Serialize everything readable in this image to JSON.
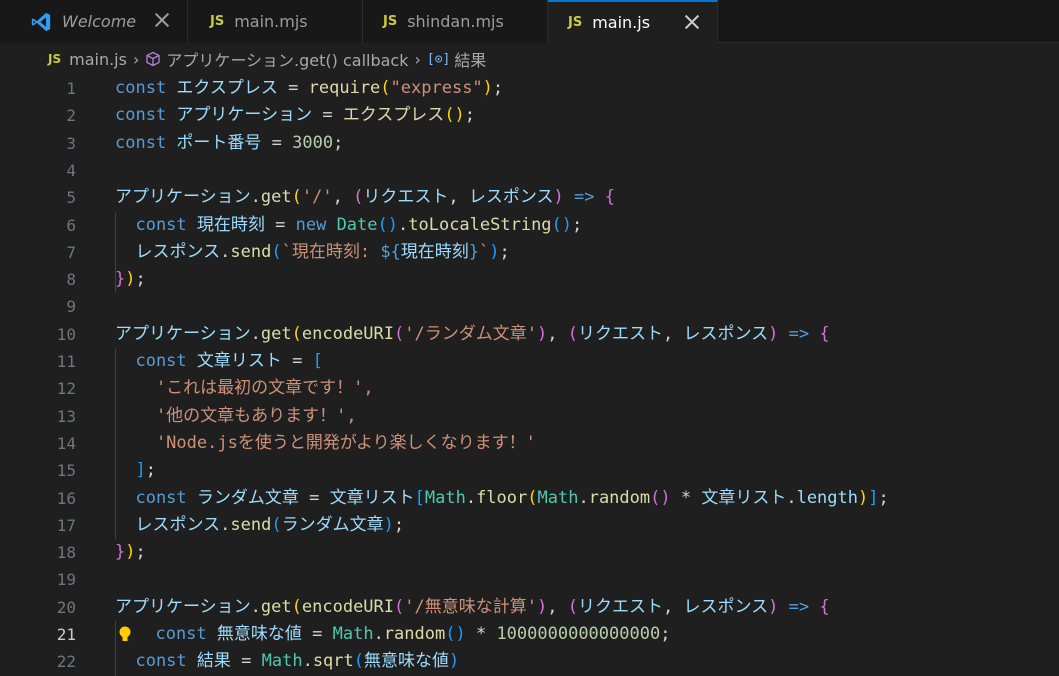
{
  "tabs": [
    {
      "label": "Welcome"
    },
    {
      "icon": "JS",
      "label": "main.mjs"
    },
    {
      "icon": "JS",
      "label": "shindan.mjs"
    },
    {
      "icon": "JS",
      "label": "main.js"
    }
  ],
  "breadcrumb": {
    "icon": "JS",
    "file": "main.js",
    "scope": "アプリケーション.get() callback",
    "symbol": "結果"
  },
  "lines": [
    {
      "n": "1",
      "tokens": [
        [
          "const ",
          "kw"
        ],
        [
          "エクスプレス",
          "var"
        ],
        [
          " = ",
          "op"
        ],
        [
          "require",
          "fn"
        ],
        [
          "(",
          "b1"
        ],
        [
          "\"express\"",
          "str"
        ],
        [
          ")",
          "b1"
        ],
        [
          ";",
          "op"
        ]
      ]
    },
    {
      "n": "2",
      "tokens": [
        [
          "const ",
          "kw"
        ],
        [
          "アプリケーション",
          "var"
        ],
        [
          " = ",
          "op"
        ],
        [
          "エクスプレス",
          "fn"
        ],
        [
          "()",
          "b1"
        ],
        [
          ";",
          "op"
        ]
      ]
    },
    {
      "n": "3",
      "tokens": [
        [
          "const ",
          "kw"
        ],
        [
          "ポート番号",
          "var"
        ],
        [
          " = ",
          "op"
        ],
        [
          "3000",
          "num"
        ],
        [
          ";",
          "op"
        ]
      ]
    },
    {
      "n": "4",
      "tokens": []
    },
    {
      "n": "5",
      "tokens": [
        [
          "アプリケーション",
          "var"
        ],
        [
          ".",
          "op"
        ],
        [
          "get",
          "fn"
        ],
        [
          "(",
          "b1"
        ],
        [
          "'/'",
          "str"
        ],
        [
          ", ",
          "op"
        ],
        [
          "(",
          "b2"
        ],
        [
          "リクエスト",
          "var"
        ],
        [
          ", ",
          "op"
        ],
        [
          "レスポンス",
          "var"
        ],
        [
          ")",
          "b2"
        ],
        [
          " => ",
          "kw"
        ],
        [
          "{",
          "b2"
        ]
      ]
    },
    {
      "n": "6",
      "tokens": [
        [
          "  const ",
          "kw"
        ],
        [
          "現在時刻",
          "var"
        ],
        [
          " = ",
          "op"
        ],
        [
          "new ",
          "kw"
        ],
        [
          "Date",
          "ty"
        ],
        [
          "()",
          "b3"
        ],
        [
          ".",
          "op"
        ],
        [
          "toLocaleString",
          "fn"
        ],
        [
          "()",
          "b3"
        ],
        [
          ";",
          "op"
        ]
      ]
    },
    {
      "n": "7",
      "tokens": [
        [
          "  レスポンス",
          "var"
        ],
        [
          ".",
          "op"
        ],
        [
          "send",
          "fn"
        ],
        [
          "(",
          "b3"
        ],
        [
          "`現在時刻: ",
          "str"
        ],
        [
          "${",
          "kw"
        ],
        [
          "現在時刻",
          "var"
        ],
        [
          "}",
          "kw"
        ],
        [
          "`",
          "str"
        ],
        [
          ")",
          "b3"
        ],
        [
          ";",
          "op"
        ]
      ]
    },
    {
      "n": "8",
      "tokens": [
        [
          "}",
          "b2"
        ],
        [
          ")",
          "b1"
        ],
        [
          ";",
          "op"
        ]
      ]
    },
    {
      "n": "9",
      "tokens": []
    },
    {
      "n": "10",
      "tokens": [
        [
          "アプリケーション",
          "var"
        ],
        [
          ".",
          "op"
        ],
        [
          "get",
          "fn"
        ],
        [
          "(",
          "b1"
        ],
        [
          "encodeURI",
          "fn"
        ],
        [
          "(",
          "b2"
        ],
        [
          "'/ランダム文章'",
          "str"
        ],
        [
          ")",
          "b2"
        ],
        [
          ", ",
          "op"
        ],
        [
          "(",
          "b2"
        ],
        [
          "リクエスト",
          "var"
        ],
        [
          ", ",
          "op"
        ],
        [
          "レスポンス",
          "var"
        ],
        [
          ")",
          "b2"
        ],
        [
          " => ",
          "kw"
        ],
        [
          "{",
          "b2"
        ]
      ]
    },
    {
      "n": "11",
      "tokens": [
        [
          "  const ",
          "kw"
        ],
        [
          "文章リスト",
          "var"
        ],
        [
          " = ",
          "op"
        ],
        [
          "[",
          "b3"
        ]
      ]
    },
    {
      "n": "12",
      "tokens": [
        [
          "    'これは最初の文章です！',",
          "str"
        ]
      ]
    },
    {
      "n": "13",
      "tokens": [
        [
          "    '他の文章もあります！',",
          "str"
        ]
      ]
    },
    {
      "n": "14",
      "tokens": [
        [
          "    'Node.jsを使うと開発がより楽しくなります！'",
          "str"
        ]
      ]
    },
    {
      "n": "15",
      "tokens": [
        [
          "  ]",
          "b3"
        ],
        [
          ";",
          "op"
        ]
      ]
    },
    {
      "n": "16",
      "tokens": [
        [
          "  const ",
          "kw"
        ],
        [
          "ランダム文章",
          "var"
        ],
        [
          " = ",
          "op"
        ],
        [
          "文章リスト",
          "var"
        ],
        [
          "[",
          "b3"
        ],
        [
          "Math",
          "ty"
        ],
        [
          ".",
          "op"
        ],
        [
          "floor",
          "fn"
        ],
        [
          "(",
          "b1"
        ],
        [
          "Math",
          "ty"
        ],
        [
          ".",
          "op"
        ],
        [
          "random",
          "fn"
        ],
        [
          "()",
          "b2"
        ],
        [
          " * ",
          "op"
        ],
        [
          "文章リスト",
          "var"
        ],
        [
          ".",
          "op"
        ],
        [
          "length",
          "var"
        ],
        [
          ")",
          "b1"
        ],
        [
          "]",
          "b3"
        ],
        [
          ";",
          "op"
        ]
      ]
    },
    {
      "n": "17",
      "tokens": [
        [
          "  レスポンス",
          "var"
        ],
        [
          ".",
          "op"
        ],
        [
          "send",
          "fn"
        ],
        [
          "(",
          "b3"
        ],
        [
          "ランダム文章",
          "var"
        ],
        [
          ")",
          "b3"
        ],
        [
          ";",
          "op"
        ]
      ]
    },
    {
      "n": "18",
      "tokens": [
        [
          "}",
          "b2"
        ],
        [
          ")",
          "b1"
        ],
        [
          ";",
          "op"
        ]
      ]
    },
    {
      "n": "19",
      "tokens": []
    },
    {
      "n": "20",
      "tokens": [
        [
          "アプリケーション",
          "var"
        ],
        [
          ".",
          "op"
        ],
        [
          "get",
          "fn"
        ],
        [
          "(",
          "b1"
        ],
        [
          "encodeURI",
          "fn"
        ],
        [
          "(",
          "b2"
        ],
        [
          "'/無意味な計算'",
          "str"
        ],
        [
          ")",
          "b2"
        ],
        [
          ", ",
          "op"
        ],
        [
          "(",
          "b2"
        ],
        [
          "リクエスト",
          "var"
        ],
        [
          ", ",
          "op"
        ],
        [
          "レスポンス",
          "var"
        ],
        [
          ")",
          "b2"
        ],
        [
          " => ",
          "kw"
        ],
        [
          "{",
          "b2"
        ]
      ]
    },
    {
      "n": "21",
      "tokens": [
        [
          "  const ",
          "kw"
        ],
        [
          "無意味な値",
          "var"
        ],
        [
          " = ",
          "op"
        ],
        [
          "Math",
          "ty"
        ],
        [
          ".",
          "op"
        ],
        [
          "random",
          "fn"
        ],
        [
          "()",
          "b3"
        ],
        [
          " * ",
          "op"
        ],
        [
          "1000000000000000",
          "num"
        ],
        [
          ";",
          "op"
        ]
      ]
    },
    {
      "n": "22",
      "tokens": [
        [
          "  const ",
          "kw"
        ],
        [
          "結果",
          "var"
        ],
        [
          " = ",
          "op"
        ],
        [
          "Math",
          "ty"
        ],
        [
          ".",
          "op"
        ],
        [
          "sqrt",
          "fn"
        ],
        [
          "(",
          "b3"
        ],
        [
          "無意味な値",
          "var"
        ],
        [
          ")",
          "b3"
        ]
      ]
    }
  ],
  "colors": {
    "background": "#1f1f1f",
    "tab_accent": "#0078d4",
    "js_badge": "#cbcb41"
  }
}
